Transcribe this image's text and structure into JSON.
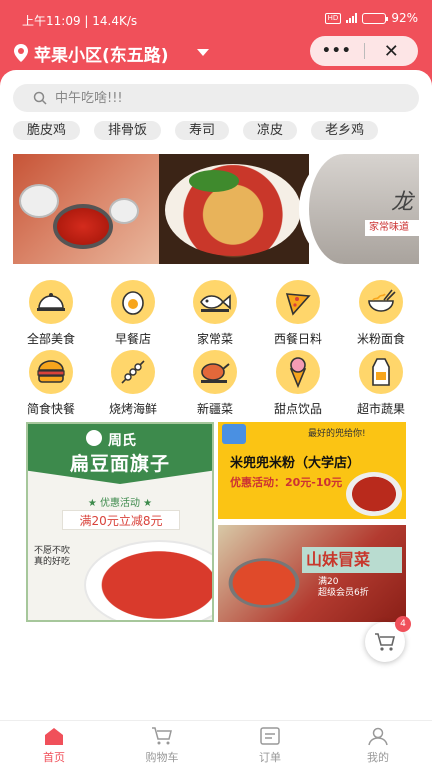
{
  "status_bar": {
    "time_speed": "上午11:09 | 14.4K/s",
    "network": "HD",
    "battery": "92%",
    "battery_level": 0.92
  },
  "header": {
    "location": "苹果小区(东五路)",
    "more_label": "•••",
    "close_label": "✕"
  },
  "search": {
    "placeholder": "中午吃啥!!!"
  },
  "hot_tags": [
    "脆皮鸡",
    "排骨饭",
    "寿司",
    "凉皮",
    "老乡鸡"
  ],
  "banner": {
    "slide3_text": "家常味道",
    "slide3_brand": "龙"
  },
  "categories": [
    {
      "label": "全部美食",
      "icon": "food-cloche-icon"
    },
    {
      "label": "早餐店",
      "icon": "egg-icon"
    },
    {
      "label": "家常菜",
      "icon": "fish-icon"
    },
    {
      "label": "西餐日料",
      "icon": "pizza-icon"
    },
    {
      "label": "米粉面食",
      "icon": "noodle-bowl-icon"
    },
    {
      "label": "简食快餐",
      "icon": "burger-icon"
    },
    {
      "label": "烧烤海鲜",
      "icon": "skewer-icon"
    },
    {
      "label": "新疆菜",
      "icon": "roast-chicken-icon"
    },
    {
      "label": "甜点饮品",
      "icon": "ice-cream-icon"
    },
    {
      "label": "超市蔬果",
      "icon": "milk-carton-icon"
    }
  ],
  "promos": {
    "left": {
      "brand": "周氏",
      "title": "扁豆面旗子",
      "promo_label": "★ 优惠活动 ★",
      "promo": "满20元立减8元",
      "side_text": "不愿不吹真的好吃"
    },
    "right_top": {
      "badge": "最好的兜给你!",
      "title": "米兜兜米粉（大学店）",
      "promo": "优惠活动：20元-10元"
    },
    "right_bottom": {
      "title": "山妹冒菜",
      "sub": "满20\n超级会员6折"
    }
  },
  "floating_cart": {
    "count": "4"
  },
  "tabbar": [
    {
      "label": "首页",
      "icon": "home-icon",
      "active": true
    },
    {
      "label": "购物车",
      "icon": "cart-icon",
      "active": false
    },
    {
      "label": "订单",
      "icon": "order-icon",
      "active": false
    },
    {
      "label": "我的",
      "icon": "user-icon",
      "active": false
    }
  ],
  "colors": {
    "brand": "#f0505a",
    "category_icon": "#ffd66b",
    "promo_green": "#3d8a4c",
    "promo_yellow": "#fbc414"
  }
}
